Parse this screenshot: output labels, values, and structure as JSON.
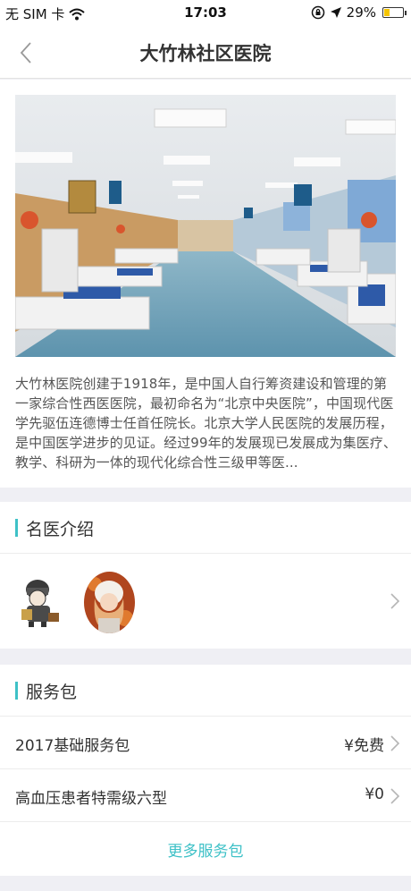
{
  "status_bar": {
    "carrier": "无 SIM 卡",
    "time": "17:03",
    "battery": "29%"
  },
  "nav": {
    "title": "大竹林社区医院"
  },
  "hospital": {
    "description": "大竹林医院创建于1918年，是中国人自行筹资建设和管理的第一家综合性西医医院，最初命名为“北京中央医院”，中国现代医学先驱伍连德博士任首任院长。北京大学人民医院的发展历程，是中国医学进步的见证。经过99年的发展现已发展成为集医疗、教学、科研为一体的现代化综合性三级甲等医..."
  },
  "doctors": {
    "title": "名医介绍"
  },
  "services": {
    "title": "服务包",
    "items": [
      {
        "name": "2017基础服务包",
        "price": "¥免费"
      },
      {
        "name": "高血压患者特需级六型",
        "price": "¥0"
      }
    ],
    "more": "更多服务包"
  },
  "colors": {
    "accent": "#3ec1c7",
    "background": "#efeff4"
  }
}
